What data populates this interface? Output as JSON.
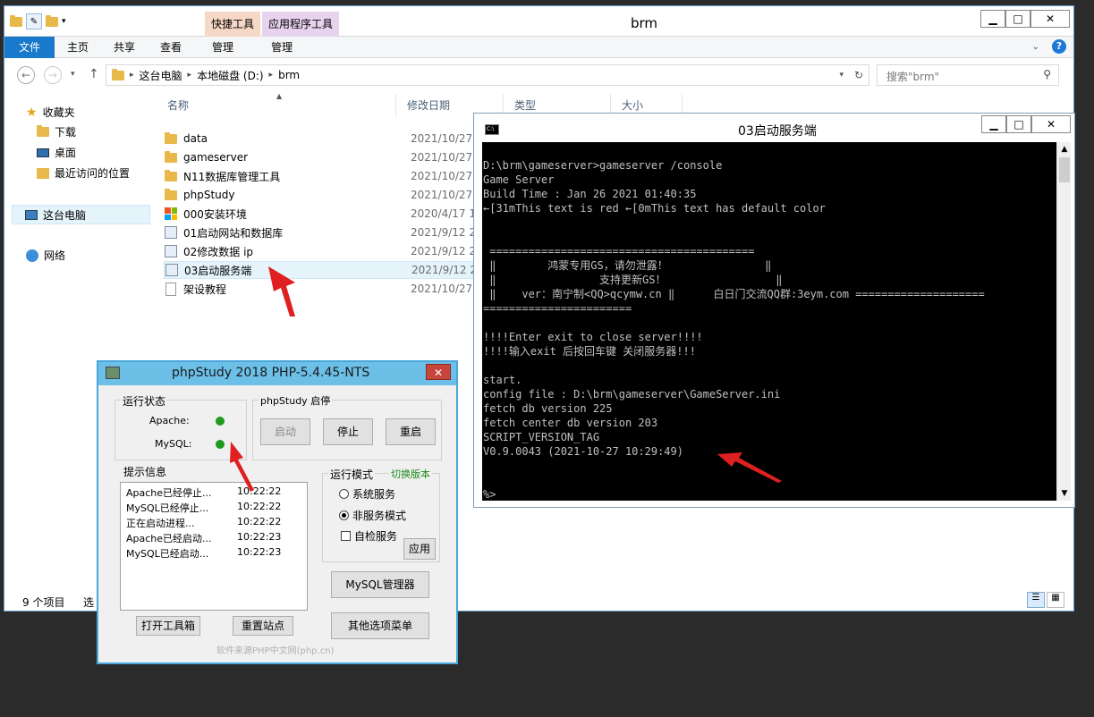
{
  "explorer": {
    "title": "brm",
    "ctx_tabs": [
      "快捷工具",
      "应用程序工具"
    ],
    "ribbon_tabs": [
      "文件",
      "主页",
      "共享",
      "查看",
      "管理",
      "管理"
    ],
    "breadcrumb": [
      "这台电脑",
      "本地磁盘 (D:)",
      "brm"
    ],
    "search_placeholder": "搜索\"brm\"",
    "nav": {
      "favorites": "收藏夹",
      "downloads": "下载",
      "desktop": "桌面",
      "recent": "最近访问的位置",
      "this_pc": "这台电脑",
      "network": "网络"
    },
    "columns": {
      "name": "名称",
      "date": "修改日期",
      "type": "类型",
      "size": "大小"
    },
    "files": [
      {
        "name": "data",
        "date": "2021/10/27 10",
        "icon": "folder-icon"
      },
      {
        "name": "gameserver",
        "date": "2021/10/27 10",
        "icon": "folder-icon"
      },
      {
        "name": "N11数据库管理工具",
        "date": "2021/10/27 10",
        "icon": "folder-icon"
      },
      {
        "name": "phpStudy",
        "date": "2021/10/27 10",
        "icon": "folder-icon"
      },
      {
        "name": "000安装环境",
        "date": "2020/4/17 16:",
        "icon": "windows-icon"
      },
      {
        "name": "01启动网站和数据库",
        "date": "2021/9/12 21:",
        "icon": "batch-icon"
      },
      {
        "name": "02修改数据 ip",
        "date": "2021/9/12 21:",
        "icon": "batch-icon"
      },
      {
        "name": "03启动服务端",
        "date": "2021/9/12 21:",
        "icon": "batch-icon"
      },
      {
        "name": "架设教程",
        "date": "2021/10/27 8:",
        "icon": "text-file-icon"
      }
    ],
    "status": {
      "count": "9 个项目",
      "selected": "选"
    }
  },
  "console": {
    "title": "03启动服务端",
    "lines": [
      "D:\\brm\\gameserver>gameserver /console",
      "Game Server",
      "Build Time : Jan 26 2021 01:40:35",
      "←[31mThis text is red ←[0mThis text has default color",
      "",
      "",
      " =========================================",
      " ‖        鸿蒙专用GS，请勿泄露！               ‖",
      " ‖                支持更新GS！                 ‖",
      " ‖    ver：南宁制<QQ>qcymw.cn ‖      白日门交流QQ群:3eym.com ====================",
      "=======================",
      "",
      "!!!!Enter exit to close server!!!!",
      "!!!!输入exit 后按回车键 关闭服务器!!!",
      "",
      "start.",
      "config file : D:\\brm\\gameserver\\GameServer.ini",
      "fetch db version 225",
      "fetch center db version 203",
      "SCRIPT_VERSION_TAG",
      "V0.9.0043 (2021-10-27 10:29:49)",
      "",
      "",
      "%>"
    ]
  },
  "phpstudy": {
    "title": "phpStudy 2018   PHP-5.4.45-NTS",
    "status_group": "运行状态",
    "apache_label": "Apache:",
    "mysql_label": "MySQL:",
    "control_group": "phpStudy 启停",
    "start_btn": "启动",
    "stop_btn": "停止",
    "restart_btn": "重启",
    "info_group": "提示信息",
    "logs": [
      {
        "msg": "Apache已经停止...",
        "time": "10:22:22"
      },
      {
        "msg": "MySQL已经停止...",
        "time": "10:22:22"
      },
      {
        "msg": "正在启动进程...",
        "time": "10:22:22"
      },
      {
        "msg": "Apache已经启动...",
        "time": "10:22:23"
      },
      {
        "msg": "MySQL已经启动...",
        "time": "10:22:23"
      }
    ],
    "mode_group": "运行模式",
    "switch_version": "切换版本",
    "mode_system": "系统服务",
    "mode_nonservice": "非服务模式",
    "self_check": "自检服务",
    "apply_btn": "应用",
    "mysql_manager_btn": "MySQL管理器",
    "toolbox_btn": "打开工具箱",
    "reset_site_btn": "重置站点",
    "other_menu_btn": "其他选项菜单",
    "footer": "软件来源PHP中文网(php.cn)",
    "colors": {
      "status_on": "#1f9a1f",
      "accent": "#4aa7d9"
    }
  }
}
